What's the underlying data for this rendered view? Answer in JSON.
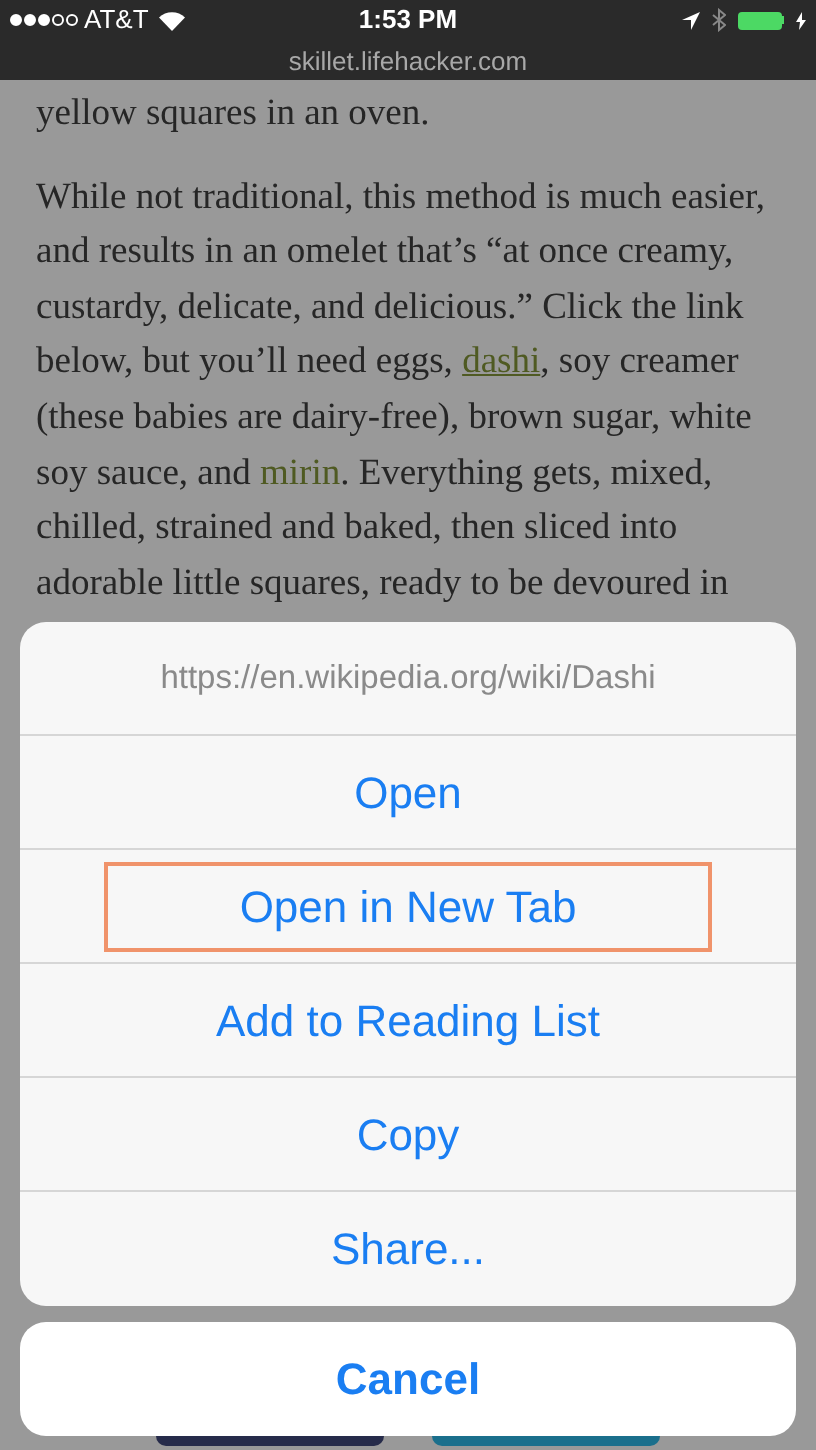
{
  "status_bar": {
    "carrier": "AT&T",
    "time": "1:53 PM"
  },
  "address_bar": {
    "domain": "skillet.lifehacker.com"
  },
  "article": {
    "paragraphs": [
      {
        "parts": [
          {
            "kind": "text",
            "text": "yellow squares in an oven."
          }
        ]
      },
      {
        "parts": [
          {
            "kind": "text",
            "text": "While not traditional, this method is much easier, and results in an omelet that’s “at once creamy, custardy, delicate, and delicious.” Click the link below, but you’ll need eggs, "
          },
          {
            "kind": "underlined_link",
            "text": "dashi"
          },
          {
            "kind": "text",
            "text": ", soy creamer (these babies are dairy-free), brown sugar, white soy sauce, and "
          },
          {
            "kind": "plain_link",
            "text": "mirin"
          },
          {
            "kind": "text",
            "text": ". Everything gets, mixed, chilled, strained and baked, then sliced into adorable little squares, ready to be devoured in"
          }
        ]
      }
    ]
  },
  "action_sheet": {
    "title": "https://en.wikipedia.org/wiki/Dashi",
    "actions": [
      {
        "label": "Open",
        "highlighted": false
      },
      {
        "label": "Open in New Tab",
        "highlighted": true
      },
      {
        "label": "Add to Reading List",
        "highlighted": false
      },
      {
        "label": "Copy",
        "highlighted": false
      },
      {
        "label": "Share...",
        "highlighted": false
      }
    ],
    "cancel": "Cancel"
  }
}
